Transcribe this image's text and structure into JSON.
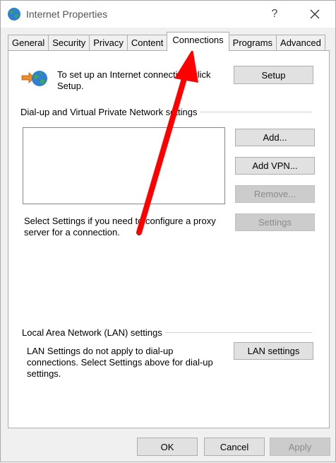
{
  "window": {
    "title": "Internet Properties",
    "help_label": "?",
    "close_icon": "close-icon"
  },
  "tabs": [
    {
      "label": "General"
    },
    {
      "label": "Security"
    },
    {
      "label": "Privacy"
    },
    {
      "label": "Content"
    },
    {
      "label": "Connections",
      "active": true
    },
    {
      "label": "Programs"
    },
    {
      "label": "Advanced"
    }
  ],
  "setup": {
    "text": "To set up an Internet connection, click Setup.",
    "button": "Setup"
  },
  "vpn": {
    "section_label": "Dial-up and Virtual Private Network settings",
    "add": "Add...",
    "add_vpn": "Add VPN...",
    "remove": "Remove...",
    "settings": "Settings",
    "proxy_text": "Select Settings if you need to configure a proxy server for a connection."
  },
  "lan": {
    "section_label": "Local Area Network (LAN) settings",
    "text": "LAN Settings do not apply to dial-up connections. Select Settings above for dial-up settings.",
    "button": "LAN settings"
  },
  "footer": {
    "ok": "OK",
    "cancel": "Cancel",
    "apply": "Apply"
  },
  "annotation": {
    "arrow_color": "#ff0000"
  }
}
